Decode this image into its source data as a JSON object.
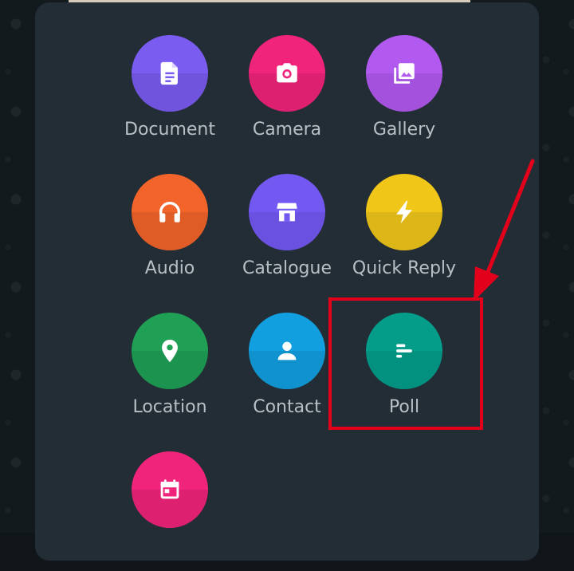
{
  "attach_menu": {
    "items": [
      {
        "label": "Document",
        "icon": "document-icon",
        "color": "#7b5cf0"
      },
      {
        "label": "Camera",
        "icon": "camera-icon",
        "color": "#f0247a"
      },
      {
        "label": "Gallery",
        "icon": "gallery-icon",
        "color": "#b25af0"
      },
      {
        "label": "Audio",
        "icon": "headphones-icon",
        "color": "#f2642a"
      },
      {
        "label": "Catalogue",
        "icon": "storefront-icon",
        "color": "#7358f2"
      },
      {
        "label": "Quick Reply",
        "icon": "lightning-icon",
        "color": "#f0c619"
      },
      {
        "label": "Location",
        "icon": "location-pin-icon",
        "color": "#1fa055"
      },
      {
        "label": "Contact",
        "icon": "person-icon",
        "color": "#129fe0"
      },
      {
        "label": "Poll",
        "icon": "poll-icon",
        "color": "#039d8a"
      },
      {
        "label": "",
        "icon": "calendar-icon",
        "color": "#f0247a"
      }
    ]
  },
  "annotation": {
    "highlight_color": "#e3001b",
    "highlighted_item": "Poll"
  }
}
